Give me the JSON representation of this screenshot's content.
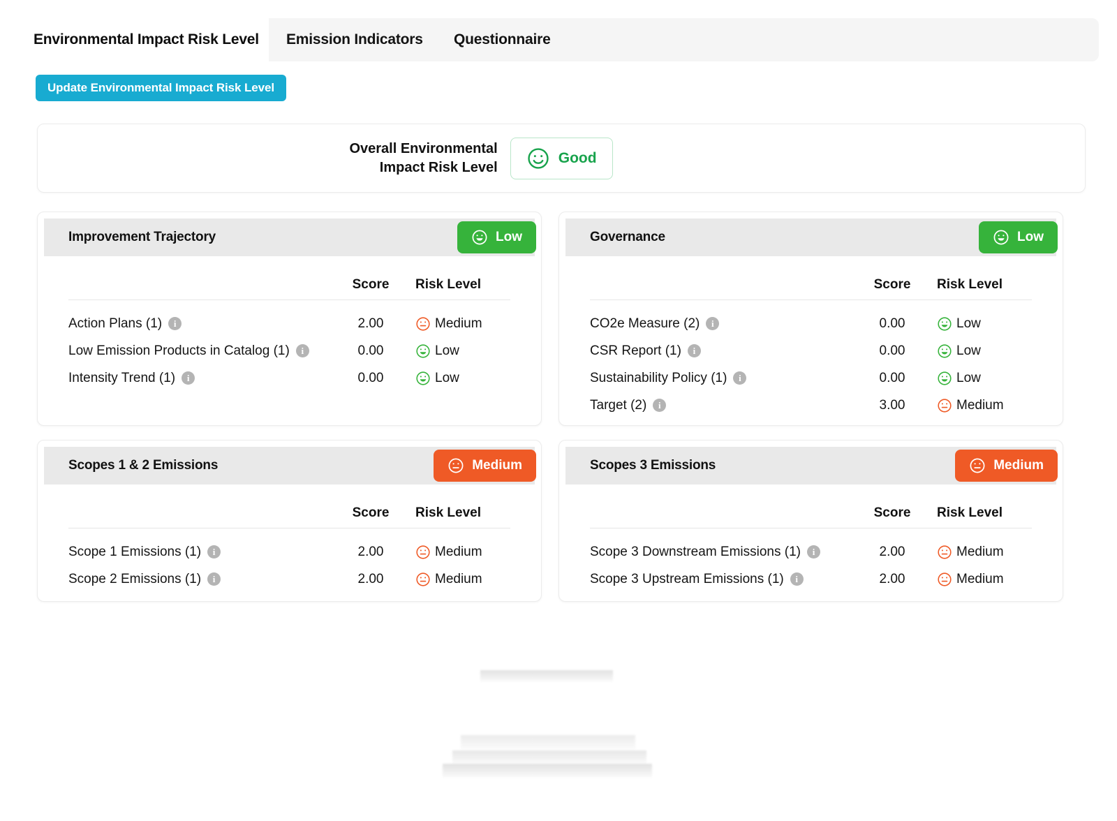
{
  "tabs": [
    {
      "label": "Environmental Impact Risk Level",
      "active": true
    },
    {
      "label": "Emission Indicators",
      "active": false
    },
    {
      "label": "Questionnaire",
      "active": false
    }
  ],
  "toolbar": {
    "update_label": "Update Environmental Impact Risk Level",
    "update_color": "#18abd1"
  },
  "overall": {
    "label": "Overall Environmental\nImpact Risk Level",
    "badge_label": "Good",
    "badge_color": "#18a34c",
    "badge_icon": "smiley-happy-icon"
  },
  "colors": {
    "low": "#36b33b",
    "medium": "#ef5a26",
    "header_gray": "#e9e9e9",
    "tabbar_gray": "#f5f5f5"
  },
  "table_headers": {
    "score": "Score",
    "risk": "Risk Level"
  },
  "cards": [
    {
      "title": "Improvement Trajectory",
      "pill_label": "Low",
      "pill_level": "low",
      "rows": [
        {
          "name": "Action Plans (1)",
          "score": "2.00",
          "risk": "Medium",
          "level": "medium"
        },
        {
          "name": "Low Emission Products in Catalog (1)",
          "score": "0.00",
          "risk": "Low",
          "level": "low"
        },
        {
          "name": "Intensity Trend (1)",
          "score": "0.00",
          "risk": "Low",
          "level": "low"
        }
      ]
    },
    {
      "title": "Governance",
      "pill_label": "Low",
      "pill_level": "low",
      "rows": [
        {
          "name": "CO2e Measure (2)",
          "score": "0.00",
          "risk": "Low",
          "level": "low"
        },
        {
          "name": "CSR Report (1)",
          "score": "0.00",
          "risk": "Low",
          "level": "low"
        },
        {
          "name": "Sustainability Policy (1)",
          "score": "0.00",
          "risk": "Low",
          "level": "low"
        },
        {
          "name": "Target (2)",
          "score": "3.00",
          "risk": "Medium",
          "level": "medium"
        }
      ]
    },
    {
      "title": "Scopes 1 & 2 Emissions",
      "pill_label": "Medium",
      "pill_level": "medium",
      "rows": [
        {
          "name": "Scope 1 Emissions (1)",
          "score": "2.00",
          "risk": "Medium",
          "level": "medium"
        },
        {
          "name": "Scope 2 Emissions (1)",
          "score": "2.00",
          "risk": "Medium",
          "level": "medium"
        }
      ]
    },
    {
      "title": "Scopes 3 Emissions",
      "pill_label": "Medium",
      "pill_level": "medium",
      "rows": [
        {
          "name": "Scope 3 Downstream Emissions (1)",
          "score": "2.00",
          "risk": "Medium",
          "level": "medium"
        },
        {
          "name": "Scope 3 Upstream Emissions (1)",
          "score": "2.00",
          "risk": "Medium",
          "level": "medium"
        }
      ]
    }
  ],
  "info_icon_glyph": "i"
}
